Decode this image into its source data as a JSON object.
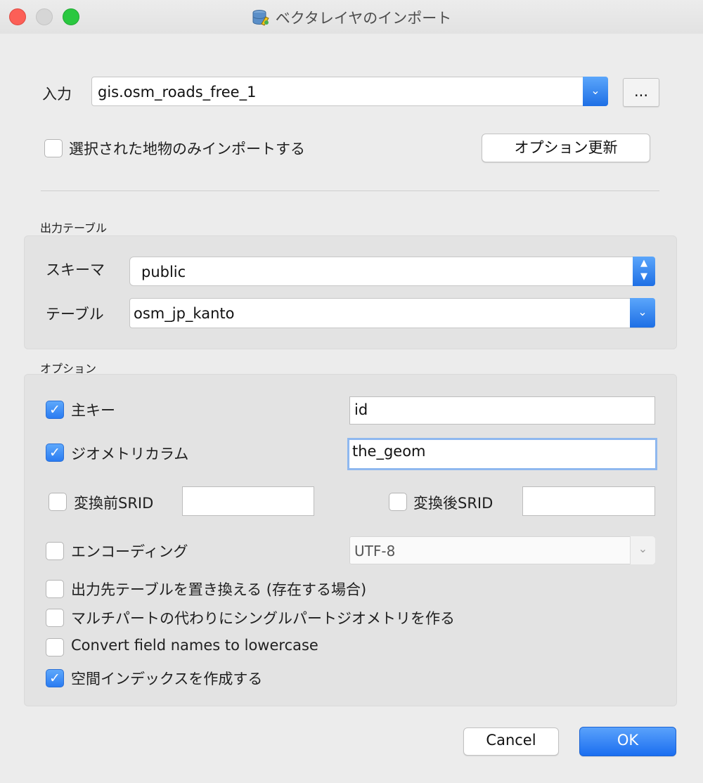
{
  "window": {
    "title": "ベクタレイヤのインポート",
    "colors": {
      "close": "#fc5f57",
      "maximize": "#2ac840",
      "accent": "#2a7cf2"
    }
  },
  "input": {
    "label": "入力",
    "value": "gis.osm_roads_free_1",
    "browse_label": "...",
    "selected_only_label": "選択された地物のみインポートする",
    "selected_only_checked": false,
    "update_options_label": "オプション更新"
  },
  "output_table": {
    "section_title": "出力テーブル",
    "schema_label": "スキーマ",
    "schema_value": "public",
    "table_label": "テーブル",
    "table_value": "osm_jp_kanto"
  },
  "options": {
    "section_title": "オプション",
    "primary_key": {
      "label": "主キー",
      "checked": true,
      "value": "id"
    },
    "geometry_column": {
      "label": "ジオメトリカラム",
      "checked": true,
      "value": "the_geom"
    },
    "source_srid": {
      "label": "変換前SRID",
      "checked": false,
      "value": ""
    },
    "target_srid": {
      "label": "変換後SRID",
      "checked": false,
      "value": ""
    },
    "encoding": {
      "label": "エンコーディング",
      "checked": false,
      "value": "UTF-8"
    },
    "replace_table": {
      "label": "出力先テーブルを置き換える (存在する場合)",
      "checked": false
    },
    "single_part": {
      "label": "マルチパートの代わりにシングルパートジオメトリを作る",
      "checked": false
    },
    "lowercase": {
      "label": "Convert field names to lowercase",
      "checked": false
    },
    "spatial_index": {
      "label": "空間インデックスを作成する",
      "checked": true
    }
  },
  "footer": {
    "cancel_label": "Cancel",
    "ok_label": "OK"
  }
}
